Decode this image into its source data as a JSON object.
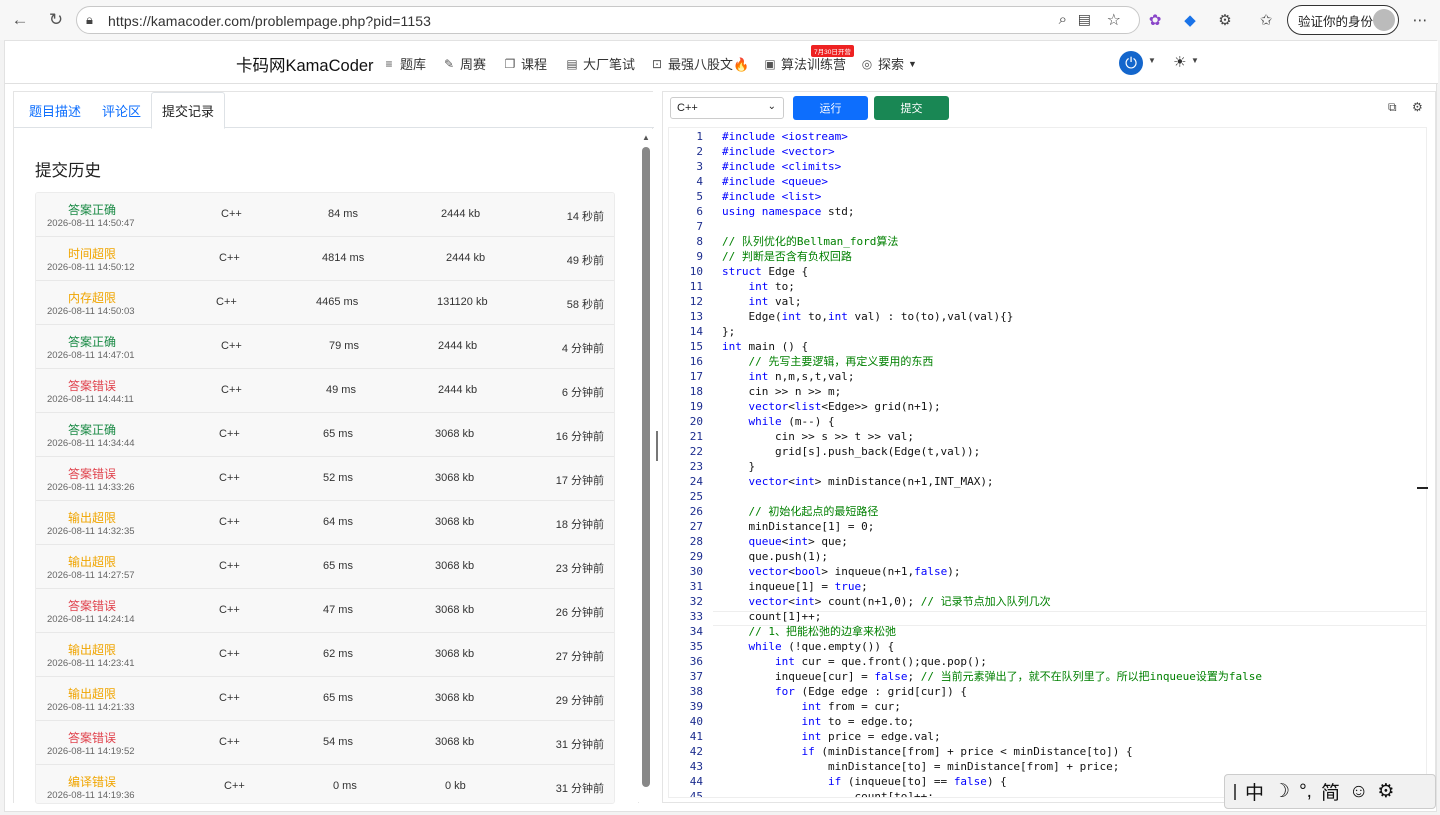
{
  "browser": {
    "url": "https://kamacoder.com/problempage.php?pid=1153",
    "verify_label": "验证你的身份"
  },
  "nav": {
    "brand": "卡码网KamaCoder",
    "items": [
      {
        "label": "题库",
        "icon": "list-icon"
      },
      {
        "label": "周赛",
        "icon": "pencil-icon"
      },
      {
        "label": "课程",
        "icon": "copy-icon"
      },
      {
        "label": "大厂笔试",
        "icon": "document-icon"
      },
      {
        "label": "最强八股文🔥",
        "icon": "code-file-icon"
      },
      {
        "label": "算法训练营",
        "icon": "calendar-icon"
      },
      {
        "label": "探索",
        "icon": "compass-icon"
      }
    ],
    "promo_badge": "7月30日开营"
  },
  "tabs": {
    "description": "题目描述",
    "comments": "评论区",
    "submissions": "提交记录"
  },
  "history": {
    "title": "提交历史",
    "rows": [
      {
        "status": "答案正确",
        "type": "ac",
        "time": "2026-08-11 14:50:47",
        "lang": "C++",
        "ms": "84 ms",
        "kb": "2444 kb",
        "ago": "14 秒前"
      },
      {
        "status": "时间超限",
        "type": "warn",
        "time": "2026-08-11 14:50:12",
        "lang": "C++",
        "ms": "4814 ms",
        "kb": "2444 kb",
        "ago": "49 秒前"
      },
      {
        "status": "内存超限",
        "type": "warn",
        "time": "2026-08-11 14:50:03",
        "lang": "C++",
        "ms": "4465 ms",
        "kb": "131120 kb",
        "ago": "58 秒前"
      },
      {
        "status": "答案正确",
        "type": "ac",
        "time": "2026-08-11 14:47:01",
        "lang": "C++",
        "ms": "79 ms",
        "kb": "2444 kb",
        "ago": "4 分钟前"
      },
      {
        "status": "答案错误",
        "type": "wa",
        "time": "2026-08-11 14:44:11",
        "lang": "C++",
        "ms": "49 ms",
        "kb": "2444 kb",
        "ago": "6 分钟前"
      },
      {
        "status": "答案正确",
        "type": "ac",
        "time": "2026-08-11 14:34:44",
        "lang": "C++",
        "ms": "65 ms",
        "kb": "3068 kb",
        "ago": "16 分钟前"
      },
      {
        "status": "答案错误",
        "type": "wa",
        "time": "2026-08-11 14:33:26",
        "lang": "C++",
        "ms": "52 ms",
        "kb": "3068 kb",
        "ago": "17 分钟前"
      },
      {
        "status": "输出超限",
        "type": "warn",
        "time": "2026-08-11 14:32:35",
        "lang": "C++",
        "ms": "64 ms",
        "kb": "3068 kb",
        "ago": "18 分钟前"
      },
      {
        "status": "输出超限",
        "type": "warn",
        "time": "2026-08-11 14:27:57",
        "lang": "C++",
        "ms": "65 ms",
        "kb": "3068 kb",
        "ago": "23 分钟前"
      },
      {
        "status": "答案错误",
        "type": "wa",
        "time": "2026-08-11 14:24:14",
        "lang": "C++",
        "ms": "47 ms",
        "kb": "3068 kb",
        "ago": "26 分钟前"
      },
      {
        "status": "输出超限",
        "type": "warn",
        "time": "2026-08-11 14:23:41",
        "lang": "C++",
        "ms": "62 ms",
        "kb": "3068 kb",
        "ago": "27 分钟前"
      },
      {
        "status": "输出超限",
        "type": "warn",
        "time": "2026-08-11 14:21:33",
        "lang": "C++",
        "ms": "65 ms",
        "kb": "3068 kb",
        "ago": "29 分钟前"
      },
      {
        "status": "答案错误",
        "type": "wa",
        "time": "2026-08-11 14:19:52",
        "lang": "C++",
        "ms": "54 ms",
        "kb": "3068 kb",
        "ago": "31 分钟前"
      },
      {
        "status": "编译错误",
        "type": "warn",
        "time": "2026-08-11 14:19:36",
        "lang": "C++",
        "ms": "0 ms",
        "kb": "0 kb",
        "ago": "31 分钟前"
      }
    ]
  },
  "editor": {
    "language": "C++",
    "run_label": "运行",
    "submit_label": "提交",
    "lines": [
      "#include <iostream>",
      "#include <vector>",
      "#include <climits>",
      "#include <queue>",
      "#include <list>",
      "using namespace std;",
      "",
      "// 队列优化的Bellman_ford算法",
      "// 判断是否含有负权回路",
      "struct Edge {",
      "    int to;",
      "    int val;",
      "    Edge(int to,int val) : to(to),val(val){}",
      "};",
      "int main () {",
      "    // 先写主要逻辑，再定义要用的东西",
      "    int n,m,s,t,val;",
      "    cin >> n >> m;",
      "    vector<list<Edge>> grid(n+1);",
      "    while (m--) {",
      "        cin >> s >> t >> val;",
      "        grid[s].push_back(Edge(t,val));",
      "    }",
      "    vector<int> minDistance(n+1,INT_MAX);",
      "",
      "    // 初始化起点的最短路径",
      "    minDistance[1] = 0;",
      "    queue<int> que;",
      "    que.push(1);",
      "    vector<bool> inqueue(n+1,false);",
      "    inqueue[1] = true;",
      "    vector<int> count(n+1,0); // 记录节点加入队列几次",
      "    count[1]++;",
      "    // 1、把能松弛的边拿来松弛",
      "    while (!que.empty()) {",
      "        int cur = que.front();que.pop();",
      "        inqueue[cur] = false; // 当前元素弹出了，就不在队列里了。所以把inqueue设置为false",
      "        for (Edge edge : grid[cur]) {",
      "            int from = cur;",
      "            int to = edge.to;",
      "            int price = edge.val;",
      "            if (minDistance[from] + price < minDistance[to]) {",
      "                minDistance[to] = minDistance[from] + price;",
      "                if (inqueue[to] == false) {",
      "                    count[to]++;"
    ]
  },
  "ime": {
    "mode": "中",
    "moon": "☽",
    "punct": "°,",
    "simplified": "简",
    "emoji": "☺",
    "settings": "⚙"
  },
  "colors": {
    "ac": "#1a8a45",
    "wa": "#e0434d",
    "warn": "#f0a500",
    "primary": "#0d6efd",
    "success": "#198754"
  }
}
